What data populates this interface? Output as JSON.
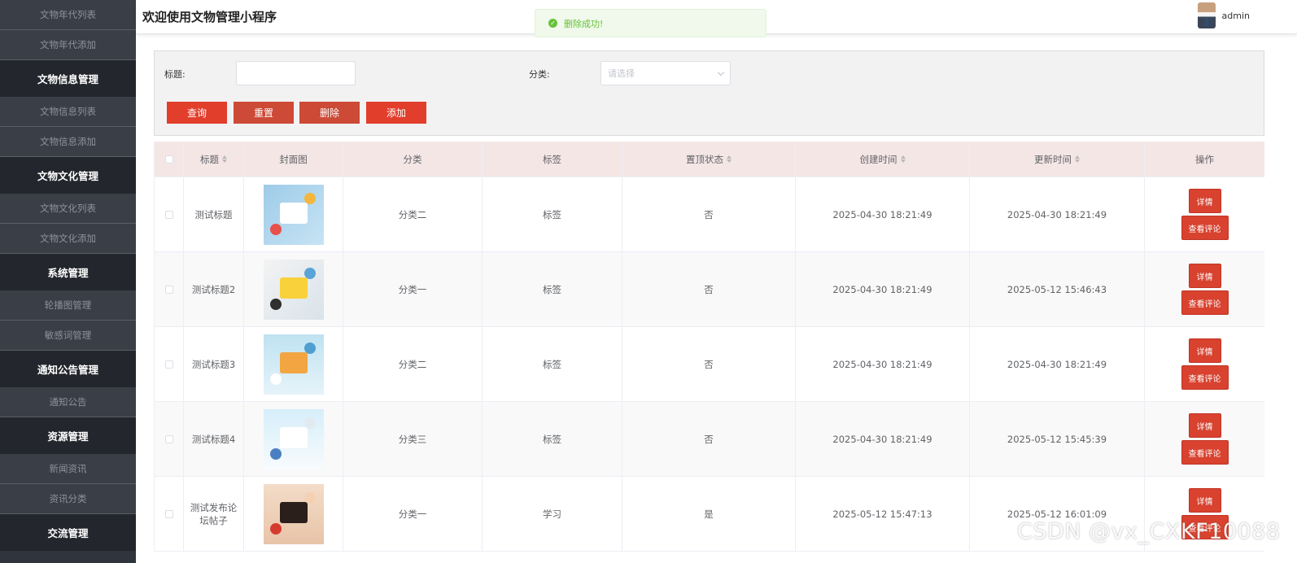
{
  "sidebar": {
    "items": [
      {
        "type": "sub",
        "label": "文物年代列表"
      },
      {
        "type": "sub",
        "label": "文物年代添加"
      },
      {
        "type": "group",
        "label": "文物信息管理"
      },
      {
        "type": "sub",
        "label": "文物信息列表"
      },
      {
        "type": "sub",
        "label": "文物信息添加"
      },
      {
        "type": "group",
        "label": "文物文化管理"
      },
      {
        "type": "sub",
        "label": "文物文化列表"
      },
      {
        "type": "sub",
        "label": "文物文化添加"
      },
      {
        "type": "group",
        "label": "系统管理"
      },
      {
        "type": "sub",
        "label": "轮播图管理"
      },
      {
        "type": "sub",
        "label": "敏感词管理"
      },
      {
        "type": "group",
        "label": "通知公告管理"
      },
      {
        "type": "sub",
        "label": "通知公告"
      },
      {
        "type": "group",
        "label": "资源管理"
      },
      {
        "type": "sub",
        "label": "新闻资讯"
      },
      {
        "type": "sub",
        "label": "资讯分类"
      },
      {
        "type": "group",
        "label": "交流管理"
      }
    ]
  },
  "header": {
    "title": "欢迎使用文物管理小程序",
    "username": "admin"
  },
  "toast": {
    "icon": "check-circle-icon",
    "message": "删除成功!",
    "color": "#67c23a"
  },
  "filter": {
    "title_label": "标题:",
    "title_value": "",
    "category_label": "分类:",
    "category_placeholder": "请选择",
    "buttons": {
      "query": "查询",
      "reset": "重置",
      "delete": "删除",
      "add": "添加"
    }
  },
  "table": {
    "columns": {
      "title": "标题",
      "cover": "封面图",
      "category": "分类",
      "tag": "标签",
      "pinned": "置顶状态",
      "created": "创建时间",
      "updated": "更新时间",
      "actions": "操作"
    },
    "rows": [
      {
        "title": "测试标题",
        "category": "分类二",
        "tag": "标签",
        "pinned": "否",
        "created": "2025-04-30 18:21:49",
        "updated": "2025-04-30 18:21:49",
        "detail": "详情",
        "comments": "查看评论"
      },
      {
        "title": "测试标题2",
        "category": "分类一",
        "tag": "标签",
        "pinned": "否",
        "created": "2025-04-30 18:21:49",
        "updated": "2025-05-12 15:46:43",
        "detail": "详情",
        "comments": "查看评论"
      },
      {
        "title": "测试标题3",
        "category": "分类二",
        "tag": "标签",
        "pinned": "否",
        "created": "2025-04-30 18:21:49",
        "updated": "2025-04-30 18:21:49",
        "detail": "详情",
        "comments": "查看评论"
      },
      {
        "title": "测试标题4",
        "category": "分类三",
        "tag": "标签",
        "pinned": "否",
        "created": "2025-04-30 18:21:49",
        "updated": "2025-05-12 15:45:39",
        "detail": "详情",
        "comments": "查看评论"
      },
      {
        "title": "测试发布论坛帖子",
        "category": "分类一",
        "tag": "学习",
        "pinned": "是",
        "created": "2025-05-12 15:47:13",
        "updated": "2025-05-12 16:01:09",
        "detail": "详情",
        "comments": "查看评论"
      }
    ]
  },
  "watermark": "CSDN @vx_CXKF10088",
  "colors": {
    "sidebar_bg": "#30343c",
    "accent_red": "#e23e2c",
    "table_header_bg": "#f5e6e6"
  }
}
